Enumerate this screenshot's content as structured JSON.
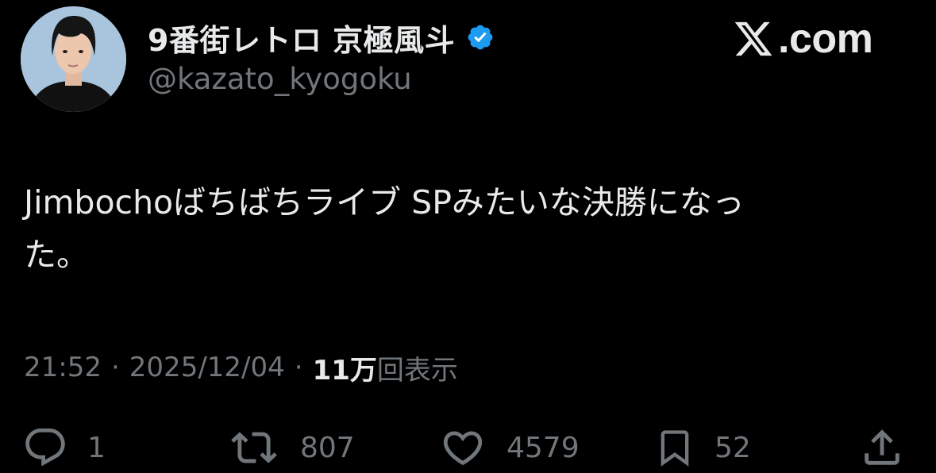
{
  "header": {
    "display_name": "9番街レトロ 京極風斗",
    "handle": "@kazato_kyogoku",
    "verified_color": "#1d9bf0",
    "brand_text": ".com"
  },
  "tweet": {
    "text": "Jimbochoばちばちライブ SPみたいな決勝になっ\nた。"
  },
  "meta": {
    "time": "21:52",
    "separator": "·",
    "date": "2025/12/04",
    "views_count": "11万",
    "views_label": "回表示"
  },
  "actions": {
    "replies": "1",
    "reposts": "807",
    "likes": "4579",
    "bookmarks": "52"
  }
}
